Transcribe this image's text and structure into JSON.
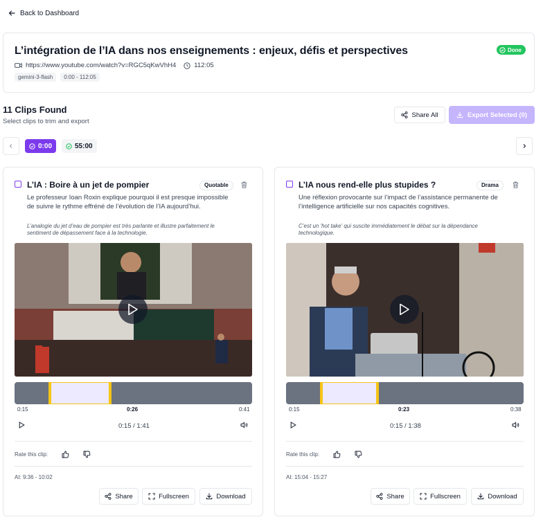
{
  "back_label": "Back to Dashboard",
  "video": {
    "title": "L’intégration de l’IA dans nos enseignements : enjeux, défis et perspectives",
    "url": "https://www.youtube.com/watch?v=RGC5qKwVhH4",
    "duration": "112:05",
    "tags": [
      "gemini-3-flash",
      "0:00 - 112:05"
    ],
    "status": "Done"
  },
  "clips_header": {
    "title": "11 Clips Found",
    "subtitle": "Select clips to trim and export",
    "share_all": "Share All",
    "export": "Export Selected (0)"
  },
  "segments": [
    {
      "label": "0:00",
      "active": true
    },
    {
      "label": "55:00",
      "active": false
    }
  ],
  "clips": [
    {
      "title": "L’IA : Boire à un jet de pompier",
      "badge": "Quotable",
      "description": "Le professeur Ioan Roxin explique pourquoi il est presque impossible de suivre le rythme effréné de l’évolution de l’IA aujourd’hui.",
      "note": "L’analogie du jet d’eau de pompier est très parlante et illustre parfaitement le sentiment de dépassement face à la technologie.",
      "range_start": "0:15",
      "range_mid": "0:26",
      "range_end": "0:41",
      "current_time": "0:15 / 1:41",
      "rate_label": "Rate this clip:",
      "ai_range": "AI: 9:36 - 10:02",
      "selection": {
        "start_fraction": 0.146,
        "end_fraction": 0.405
      },
      "share": "Share",
      "fullscreen": "Fullscreen",
      "download": "Download"
    },
    {
      "title": "L’IA nous rend-elle plus stupides ?",
      "badge": "Drama",
      "description": "Une réflexion provocante sur l’impact de l’assistance permanente de l’intelligence artificielle sur nos capacités cognitives.",
      "note": "C’est un 'hot take' qui suscite immédiatement le débat sur la dépendance technologique.",
      "range_start": "0:15",
      "range_mid": "0:23",
      "range_end": "0:38",
      "current_time": "0:15 / 1:38",
      "rate_label": "Rate this clip:",
      "ai_range": "AI: 15:04 - 15:27",
      "selection": {
        "start_fraction": 0.146,
        "end_fraction": 0.388
      },
      "share": "Share",
      "fullscreen": "Fullscreen",
      "download": "Download"
    }
  ],
  "colors": {
    "accent": "#7c3aed",
    "done": "#22c55e",
    "handle": "#f5c518",
    "export_disabled": "#c4b5fd"
  }
}
